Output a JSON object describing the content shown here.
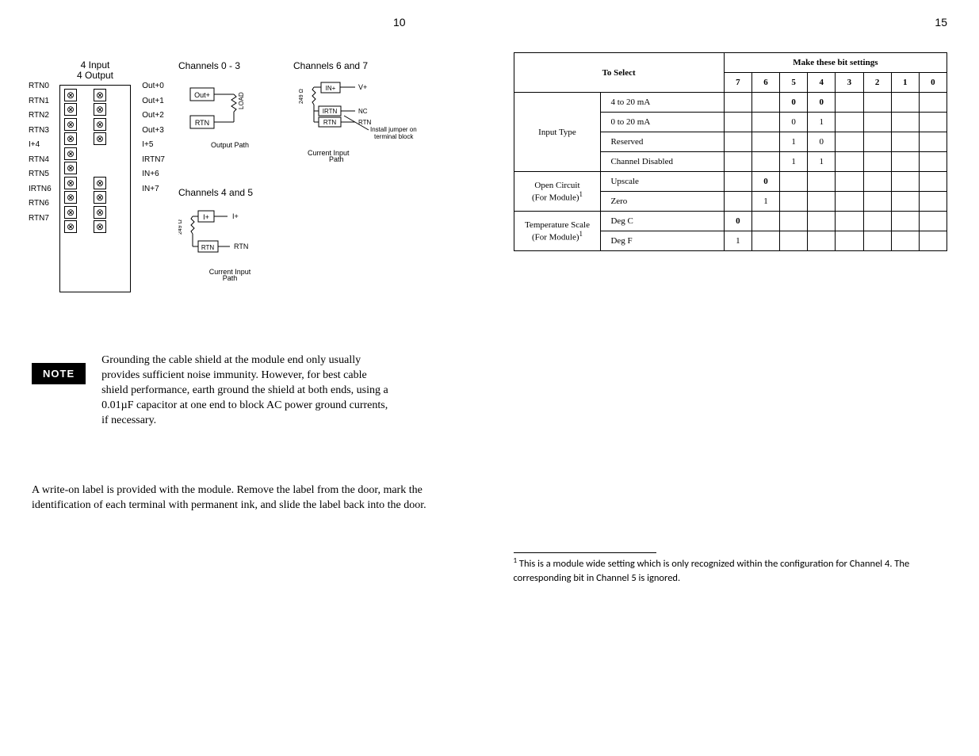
{
  "pageLeft": "10",
  "pageRight": "15",
  "diagram": {
    "header1": "4 Input",
    "header2": "4 Output",
    "leftLabels": [
      "RTN0",
      "RTN1",
      "RTN2",
      "RTN3",
      "I+4",
      "RTN4",
      "RTN5",
      "IRTN6",
      "RTN6",
      "RTN7"
    ],
    "rightLabels": [
      "Out+0",
      "Out+1",
      "Out+2",
      "Out+3",
      "",
      "",
      "I+5",
      "IRTN7",
      "IN+6",
      "IN+7"
    ],
    "ch03_title": "Channels 0 - 3",
    "ch03_out": "Out+",
    "ch03_rtn": "RTN",
    "ch03_load": "LOAD",
    "ch03_sub": "Output Path",
    "ch45_title": "Channels 4 and 5",
    "ch45_iplus": "I+",
    "ch45_iplus2": "I+",
    "ch45_res": "249 Ω",
    "ch45_rtn": "RTN",
    "ch45_rtn2": "RTN",
    "ch45_sub1": "Current Input",
    "ch45_sub2": "Path",
    "ch67_title": "Channels 6 and 7",
    "ch67_in": "IN+",
    "ch67_v": "V+",
    "ch67_res": "249 Ω",
    "ch67_irtn": "IRTN",
    "ch67_rtn": "RTN",
    "ch67_nc": "NC",
    "ch67_rtn2": "RTN",
    "ch67_jumper1": "Install jumper on",
    "ch67_jumper2": "terminal block",
    "ch67_sub1": "Current Input",
    "ch67_sub2": "Path"
  },
  "note": {
    "badge": "NOTE",
    "text": "Grounding the cable shield at the module end only usually provides sufficient noise immunity. However, for best cable shield performance, earth ground the shield at both ends, using a 0.01µF capacitor at one end to block AC power ground currents, if necessary."
  },
  "bodyPara": "A write-on label is provided with the module. Remove the label from the door, mark the identification of each terminal with permanent ink, and slide the label back into the door.",
  "table": {
    "headerSpan": "Make these bit settings",
    "toSelect": "To Select",
    "bits": [
      "7",
      "6",
      "5",
      "4",
      "3",
      "2",
      "1",
      "0"
    ],
    "groups": [
      {
        "name": "Input Type",
        "rows": [
          {
            "label": "4 to 20 mA",
            "cells": [
              "",
              "",
              "0b",
              "0b",
              "",
              "",
              "",
              ""
            ]
          },
          {
            "label": "0 to 20 mA",
            "cells": [
              "",
              "",
              "0",
              "1",
              "",
              "",
              "",
              ""
            ]
          },
          {
            "label": "Reserved",
            "cells": [
              "",
              "",
              "1",
              "0",
              "",
              "",
              "",
              ""
            ]
          },
          {
            "label": "Channel Disabled",
            "cells": [
              "",
              "",
              "1",
              "1",
              "",
              "",
              "",
              ""
            ]
          }
        ]
      },
      {
        "name": "Open Circuit (For Module)",
        "sup": "1",
        "rows": [
          {
            "label": "Upscale",
            "cells": [
              "",
              "0b",
              "",
              "",
              "",
              "",
              "",
              ""
            ]
          },
          {
            "label": "Zero",
            "cells": [
              "",
              "1",
              "",
              "",
              "",
              "",
              "",
              ""
            ]
          }
        ]
      },
      {
        "name": "Temperature Scale (For Module)",
        "sup": "1",
        "rows": [
          {
            "label": "Deg C",
            "cells": [
              "0b",
              "",
              "",
              "",
              "",
              "",
              "",
              ""
            ]
          },
          {
            "label": "Deg F",
            "cells": [
              "1",
              "",
              "",
              "",
              "",
              "",
              "",
              ""
            ]
          }
        ]
      }
    ]
  },
  "footnote": {
    "num": "1",
    "text": "This is a module wide setting which is only recognized within the configuration for Channel 4. The corresponding bit in Channel 5 is ignored."
  }
}
